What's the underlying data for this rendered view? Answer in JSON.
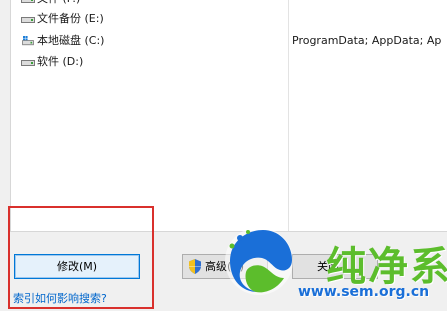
{
  "list": {
    "rows": [
      {
        "name": "文件 (F:)",
        "exclusions": ""
      },
      {
        "name": "文件备份 (E:)",
        "exclusions": ""
      },
      {
        "name": "本地磁盘 (C:)",
        "exclusions": "ProgramData; AppData; Ap"
      },
      {
        "name": "软件 (D:)",
        "exclusions": ""
      }
    ]
  },
  "buttons": {
    "modify_label": "修改(M)",
    "advanced_label": "高级(D)",
    "close_label": "关闭"
  },
  "help_link": "索引如何影响搜索?",
  "watermark": {
    "brand": "纯净系统家园",
    "url": "www.sem.org.cn"
  },
  "colors": {
    "highlight": "#d9302c",
    "link": "#0066cc",
    "selected_button_border": "#0078d7",
    "watermark_green": "#5cbd2c",
    "watermark_blue": "#1a6fd8"
  },
  "icons": {
    "drive": "drive-icon",
    "system_drive": "windows-drive-icon",
    "uac": "uac-shield-icon"
  }
}
